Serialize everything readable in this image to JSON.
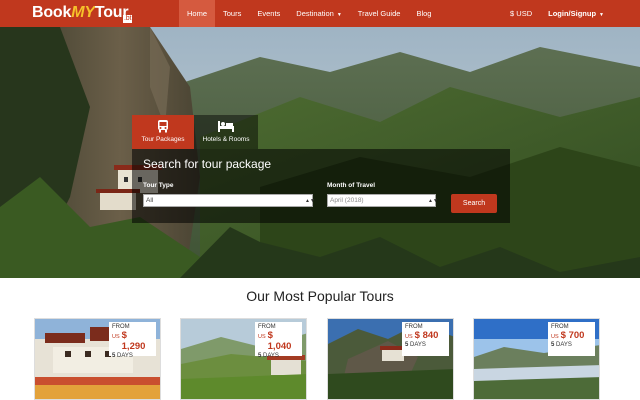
{
  "brand": {
    "book": "Book",
    "my": "MY",
    "tour": "Tour",
    "tld": ".bt"
  },
  "nav": {
    "items": [
      {
        "label": "Home"
      },
      {
        "label": "Tours"
      },
      {
        "label": "Events"
      },
      {
        "label": "Destination"
      },
      {
        "label": "Travel Guide"
      },
      {
        "label": "Blog"
      }
    ],
    "currency": "$ USD",
    "login": "Login/Signup"
  },
  "search": {
    "tabs": [
      {
        "label": "Tour Packages",
        "icon": "bus-icon"
      },
      {
        "label": "Hotels & Rooms",
        "icon": "bed-icon"
      }
    ],
    "title": "Search for tour package",
    "tour_type_label": "Tour Type",
    "tour_type_value": "All",
    "month_label": "Month of Travel",
    "month_value": "April (2018)",
    "button": "Search"
  },
  "popular": {
    "title": "Our Most Popular Tours",
    "cards": [
      {
        "from": "FROM",
        "currency": "US",
        "price": "$ 1,290",
        "days_num": "5",
        "days_word": "DAYS"
      },
      {
        "from": "FROM",
        "currency": "US",
        "price": "$ 1,040",
        "days_num": "5",
        "days_word": "DAYS"
      },
      {
        "from": "FROM",
        "currency": "US",
        "price": "$ 840",
        "days_num": "5",
        "days_word": "DAYS"
      },
      {
        "from": "FROM",
        "currency": "US",
        "price": "$ 700",
        "days_num": "5",
        "days_word": "DAYS"
      }
    ]
  },
  "colors": {
    "brand_red": "#c0381e",
    "logo_yellow": "#f6c12a"
  }
}
